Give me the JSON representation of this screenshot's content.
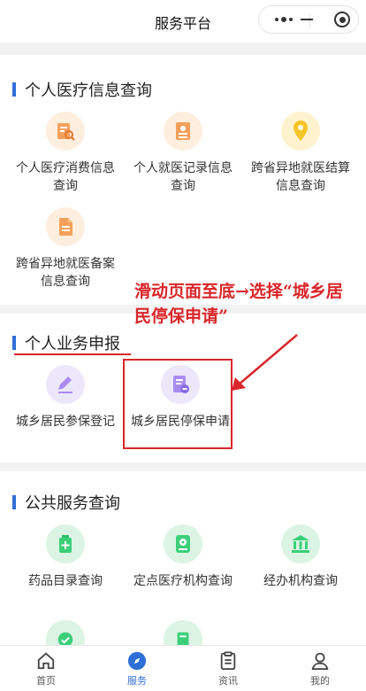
{
  "header": {
    "title": "服务平台"
  },
  "sections": {
    "medical": {
      "title": "个人医疗信息查询",
      "items": [
        {
          "label": "个人医疗消费信息查询",
          "icon": "magnifier-doc-icon"
        },
        {
          "label": "个人就医记录信息查询",
          "icon": "person-card-icon"
        },
        {
          "label": "跨省异地就医结算信息查询",
          "icon": "location-pin-icon"
        },
        {
          "label": "跨省异地就医备案信息查询",
          "icon": "document-icon"
        }
      ]
    },
    "business": {
      "title": "个人业务申报",
      "items": [
        {
          "label": "城乡居民参保登记",
          "icon": "pen-icon"
        },
        {
          "label": "城乡居民停保申请",
          "icon": "form-stop-icon"
        }
      ]
    },
    "public": {
      "title": "公共服务查询",
      "items": [
        {
          "label": "药品目录查询",
          "icon": "medicine-bottle-icon"
        },
        {
          "label": "定点医疗机构查询",
          "icon": "hospital-pin-icon"
        },
        {
          "label": "经办机构查询",
          "icon": "institution-icon"
        }
      ]
    }
  },
  "annotation": {
    "text": "滑动页面至底→选择“城乡居民停保申请”"
  },
  "nav": {
    "items": [
      {
        "label": "首页",
        "icon": "home-icon"
      },
      {
        "label": "服务",
        "icon": "compass-icon"
      },
      {
        "label": "资讯",
        "icon": "news-icon"
      },
      {
        "label": "我的",
        "icon": "user-icon"
      }
    ]
  },
  "colors": {
    "accent": "#2f6fd8",
    "annotation": "#d9262a"
  }
}
